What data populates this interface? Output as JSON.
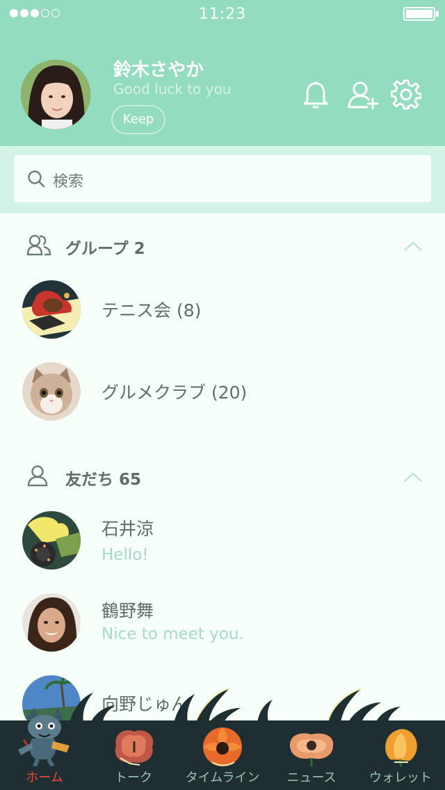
{
  "status_bar": {
    "time": "11:23"
  },
  "profile": {
    "name": "鈴木さやか",
    "status_message": "Good luck to you",
    "keep_label": "Keep"
  },
  "search": {
    "placeholder": "検索"
  },
  "groups": {
    "title": "グループ 2",
    "items": [
      {
        "name": "テニス会 (8)"
      },
      {
        "name": "グルメクラブ (20)"
      }
    ]
  },
  "friends": {
    "title": "友だち 65",
    "items": [
      {
        "name": "石井涼",
        "message": "Hello!"
      },
      {
        "name": "鶴野舞",
        "message": "Nice to meet you."
      },
      {
        "name": "向野じゅん",
        "message": ""
      }
    ]
  },
  "tabs": [
    {
      "label": "ホーム",
      "icon": "home-character-icon",
      "active": true
    },
    {
      "label": "トーク",
      "icon": "talk-flower-icon",
      "active": false
    },
    {
      "label": "タイムライン",
      "icon": "timeline-flower-icon",
      "active": false
    },
    {
      "label": "ニュース",
      "icon": "news-flower-icon",
      "active": false
    },
    {
      "label": "ウォレット",
      "icon": "wallet-flower-icon",
      "active": false
    }
  ],
  "colors": {
    "header": "#94dcc0",
    "search_band": "#d2f3e5",
    "background": "#f6fff9",
    "tabbar": "#1f2e31",
    "active_tab": "#f0473c",
    "message_text": "#a6dcc6"
  }
}
